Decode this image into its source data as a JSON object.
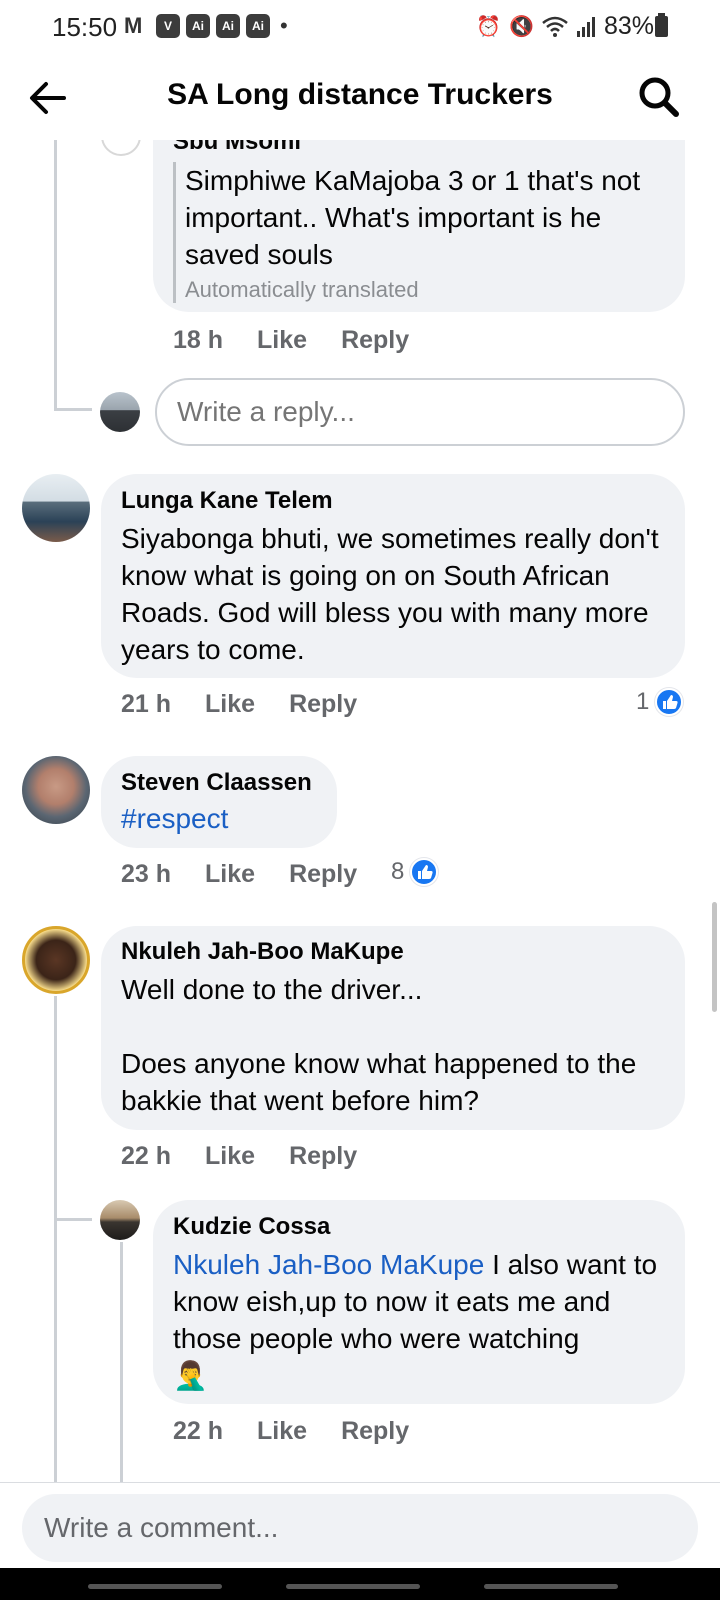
{
  "status_bar": {
    "time": "15:50",
    "left_icons": [
      "mail-icon",
      "v-app-icon",
      "ai-app-icon",
      "ai-app-icon",
      "ai-app-icon"
    ],
    "app_badges": [
      "V",
      "Ai",
      "Ai",
      "Ai"
    ],
    "battery": "83%",
    "right_icons": [
      "alarm-icon",
      "mute-icon",
      "wifi-icon",
      "signal-icon",
      "battery-icon"
    ]
  },
  "header": {
    "title": "SA Long distance Truckers"
  },
  "comments": [
    {
      "author": "Sbu Msomi",
      "text": "Simphiwe KaMajoba 3 or 1 that's not important.. What's important is he saved souls",
      "translation_note": "Automatically translated",
      "time": "18 h",
      "like": "Like",
      "reply": "Reply"
    },
    {
      "author": "Lunga Kane Telem",
      "text": "Siyabonga bhuti, we sometimes really don't know what is going on on South African Roads. God will bless you with many more years to come.",
      "time": "21 h",
      "like": "Like",
      "reply": "Reply",
      "reactions": "1"
    },
    {
      "author": "Steven Claassen",
      "text": "#respect",
      "time": "23 h",
      "like": "Like",
      "reply": "Reply",
      "reactions": "8"
    },
    {
      "author": "Nkuleh Jah-Boo MaKupe",
      "text_line1": "Well done to the driver...",
      "text_line2": "Does anyone know what happened  to the bakkie that went before him?",
      "time": "22 h",
      "like": "Like",
      "reply": "Reply"
    },
    {
      "author": "Kudzie Cossa",
      "mention": "Nkuleh Jah-Boo MaKupe",
      "text": " I also want to know eish,up to now it eats me and those people who were watching",
      "emoji": "🤦‍♂️",
      "time": "22 h",
      "like": "Like",
      "reply": "Reply"
    }
  ],
  "reply_box": {
    "placeholder": "Write a reply..."
  },
  "comment_box": {
    "placeholder": "Write a comment..."
  },
  "colors": {
    "bubble": "#f0f2f5",
    "meta_text": "#65676b",
    "mention": "#1a5fc4",
    "like_blue": "#1877f2"
  }
}
